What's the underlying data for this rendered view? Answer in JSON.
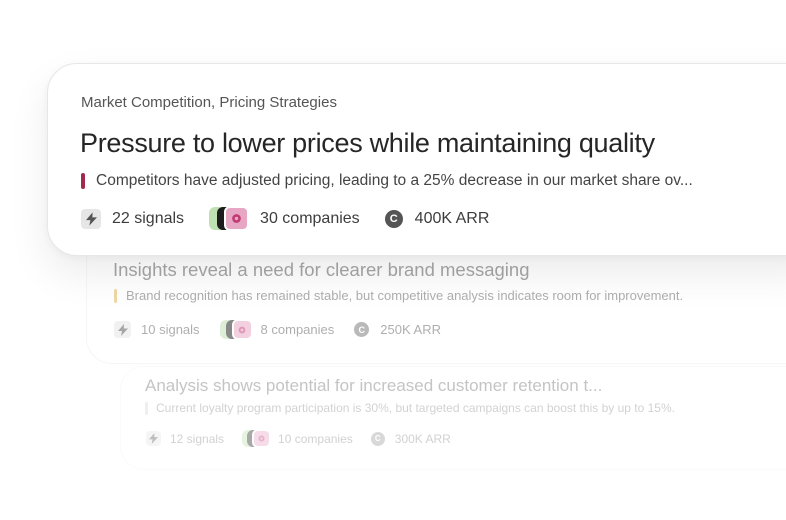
{
  "cards": [
    {
      "tags": "Market Competition, Pricing Strategies",
      "title": "Pressure to lower prices while maintaining quality",
      "description": "Competitors have adjusted pricing, leading to a 25% decrease in our market share ov...",
      "signals": "22 signals",
      "companies": "30 companies",
      "arr": "400K ARR",
      "accent": "#a22a4d"
    },
    {
      "title": "Insights reveal a need for clearer brand messaging",
      "description": "Brand recognition has remained stable, but competitive analysis indicates room for improvement.",
      "signals": "10 signals",
      "companies": "8 companies",
      "arr": "250K ARR",
      "accent": "#e4b357"
    },
    {
      "title": "Analysis shows potential for increased customer retention t...",
      "description": "Current loyalty program participation is 30%, but targeted campaigns can boost this by up to 15%.",
      "signals": "12 signals",
      "companies": "10 companies",
      "arr": "300K ARR",
      "accent": "#d6d6d6"
    }
  ],
  "icons": {
    "signals": "bolt-icon",
    "companies": "company-logos-icon",
    "arr": "arr-coin-icon",
    "arr_glyph": "C"
  }
}
